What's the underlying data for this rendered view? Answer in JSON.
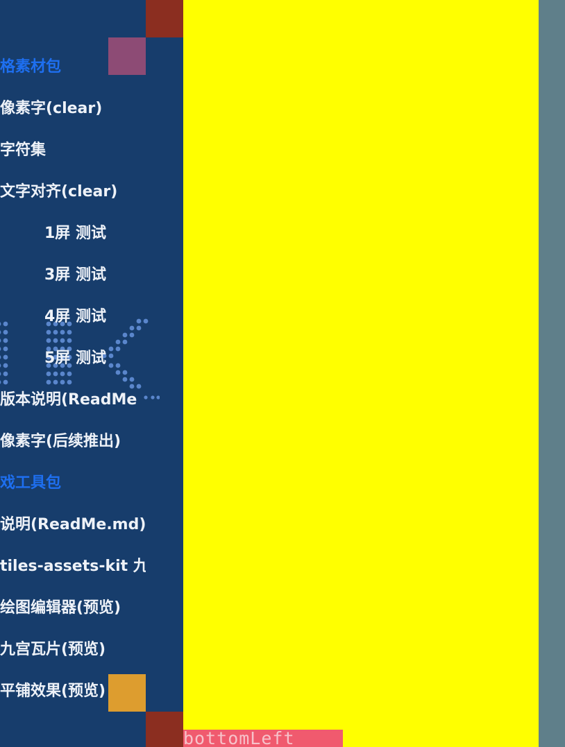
{
  "sidebar": {
    "items": [
      {
        "label": "格素材包",
        "kind": "section"
      },
      {
        "label": "像素字(clear)",
        "kind": "item"
      },
      {
        "label": " 字符集",
        "kind": "item"
      },
      {
        "label": " 文字对齐(clear)",
        "kind": "item"
      },
      {
        "label": "1屏 测试",
        "kind": "sub"
      },
      {
        "label": "3屏 测试",
        "kind": "sub"
      },
      {
        "label": "4屏 测试",
        "kind": "sub"
      },
      {
        "label": "5屏 测试",
        "kind": "sub"
      },
      {
        "label": " 版本说明(ReadMe",
        "kind": "item"
      },
      {
        "label": "像素字(后续推出)",
        "kind": "item"
      },
      {
        "label": "戏工具包",
        "kind": "section"
      },
      {
        "label": "说明(ReadMe.md)",
        "kind": "item"
      },
      {
        "label": "tiles-assets-kit 九宫",
        "kind": "item"
      },
      {
        "label": "绘图编辑器(预览)",
        "kind": "item"
      },
      {
        "label": "九宫瓦片(预览)",
        "kind": "item"
      },
      {
        "label": "平铺效果(预览)",
        "kind": "item"
      }
    ]
  },
  "canvas": {
    "corner_label": "bottomLeft",
    "colors": {
      "panel": "#ffff00",
      "sidebar": "#173d6c",
      "background": "#5f7f8a",
      "accent_red": "#8b2e20",
      "accent_purple": "#8d4b75",
      "accent_orange": "#dd9d2f",
      "label_bg": "#f05a6e",
      "section_text": "#1e6ff0"
    }
  }
}
